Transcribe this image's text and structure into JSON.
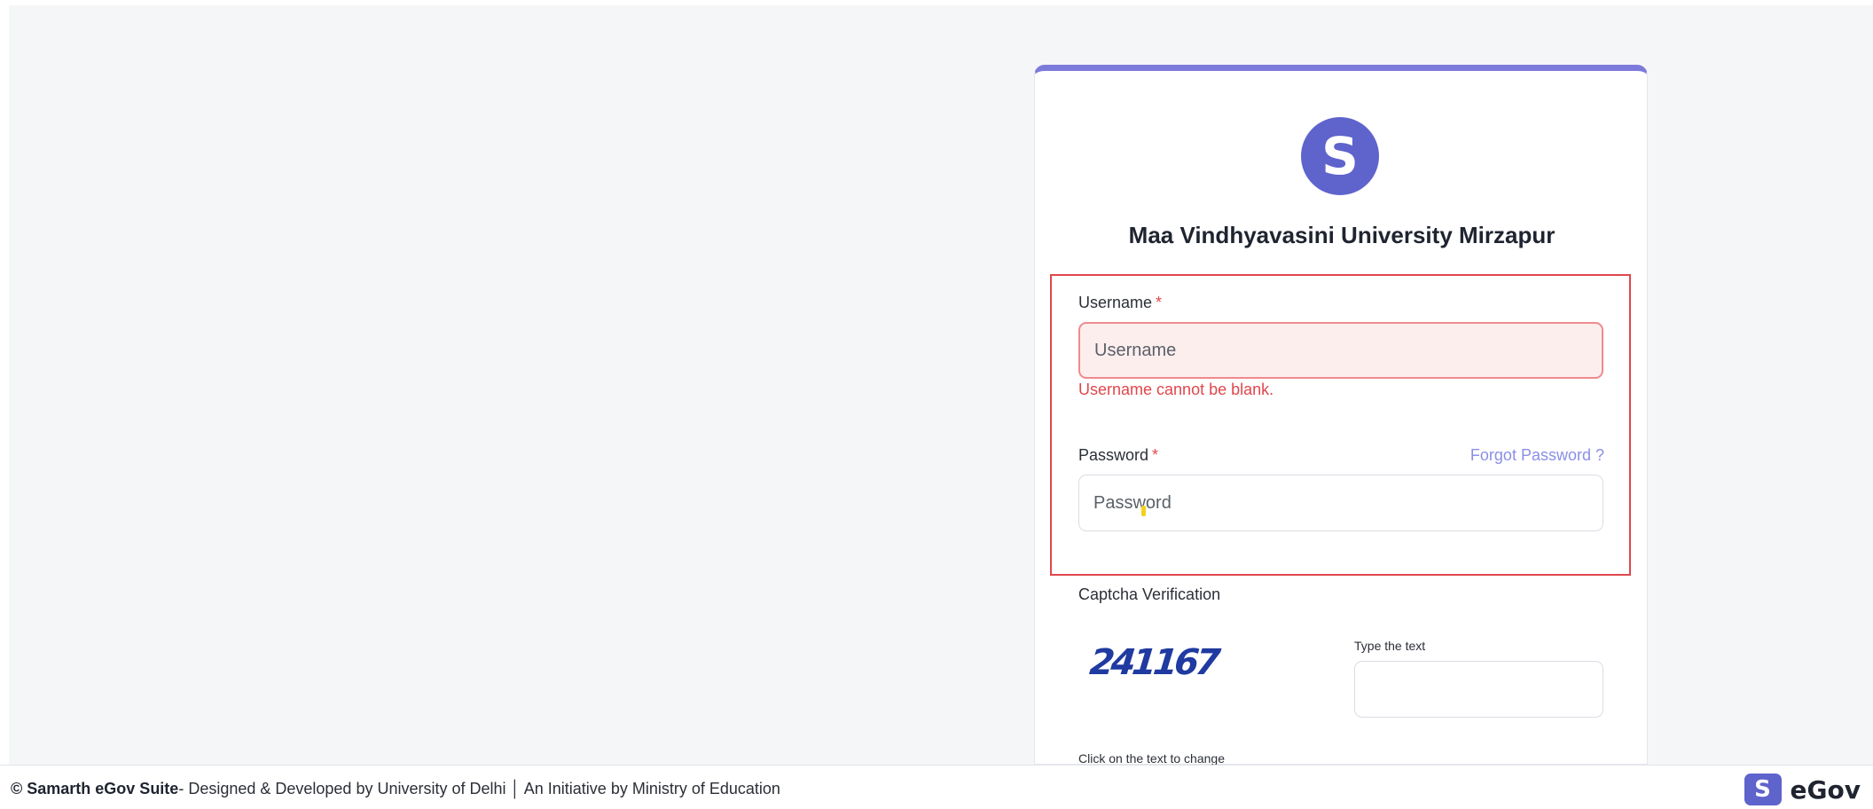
{
  "login_card": {
    "logo_letter": "S",
    "university_name": "Maa Vindhyavasini University Mirzapur",
    "username": {
      "label": "Username",
      "required_mark": "*",
      "placeholder": "Username",
      "value": "",
      "error": "Username cannot be blank."
    },
    "password": {
      "label": "Password",
      "required_mark": "*",
      "placeholder": "Password",
      "value": "",
      "forgot_link": "Forgot Password ?"
    },
    "captcha": {
      "heading": "Captcha Verification",
      "image_text": "241167",
      "input_label": "Type the text",
      "input_value": "",
      "change_hint": "Click on the text to change"
    }
  },
  "footer": {
    "copyright_brand": "© Samarth eGov Suite",
    "credit": "- Designed & Developed by University of Delhi │ An Initiative by Ministry of Education",
    "logo_letter": "S",
    "logo_text": "eGov"
  },
  "colors": {
    "accent": "#5f63cc",
    "card_top_border": "#7c7bdc",
    "error": "#e0474c",
    "link": "#8a8fe6",
    "captcha_text": "#1f3aa0"
  }
}
